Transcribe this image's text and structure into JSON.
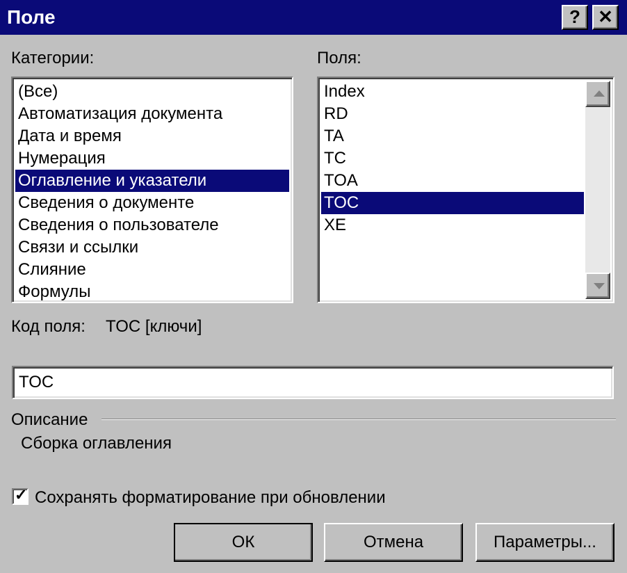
{
  "window": {
    "title": "Поле",
    "help_label": "?",
    "close_label": "✕"
  },
  "categories": {
    "label": "Категории:",
    "items": [
      "(Все)",
      "Автоматизация документа",
      "Дата и время",
      "Нумерация",
      "Оглавление и указатели",
      "Сведения о документе",
      "Сведения о пользователе",
      "Связи и ссылки",
      "Слияние",
      "Формулы"
    ],
    "selected_index": 4
  },
  "fields": {
    "label": "Поля:",
    "items": [
      "Index",
      "RD",
      "TA",
      "TC",
      "TOA",
      "TOC",
      "XE"
    ],
    "selected_index": 5
  },
  "field_code": {
    "label": "Код поля:",
    "syntax": "TOC [ключи]",
    "value": "TOC"
  },
  "description": {
    "label": "Описание",
    "text": "Сборка оглавления"
  },
  "preserve_formatting": {
    "label": "Сохранять форматирование при обновлении",
    "checked": true,
    "check_glyph": "✓"
  },
  "buttons": {
    "ok": "ОК",
    "cancel": "Отмена",
    "options": "Параметры..."
  },
  "colors": {
    "titlebar": "#0a0a78",
    "selection": "#0a0a78",
    "face": "#c0c0c0"
  }
}
